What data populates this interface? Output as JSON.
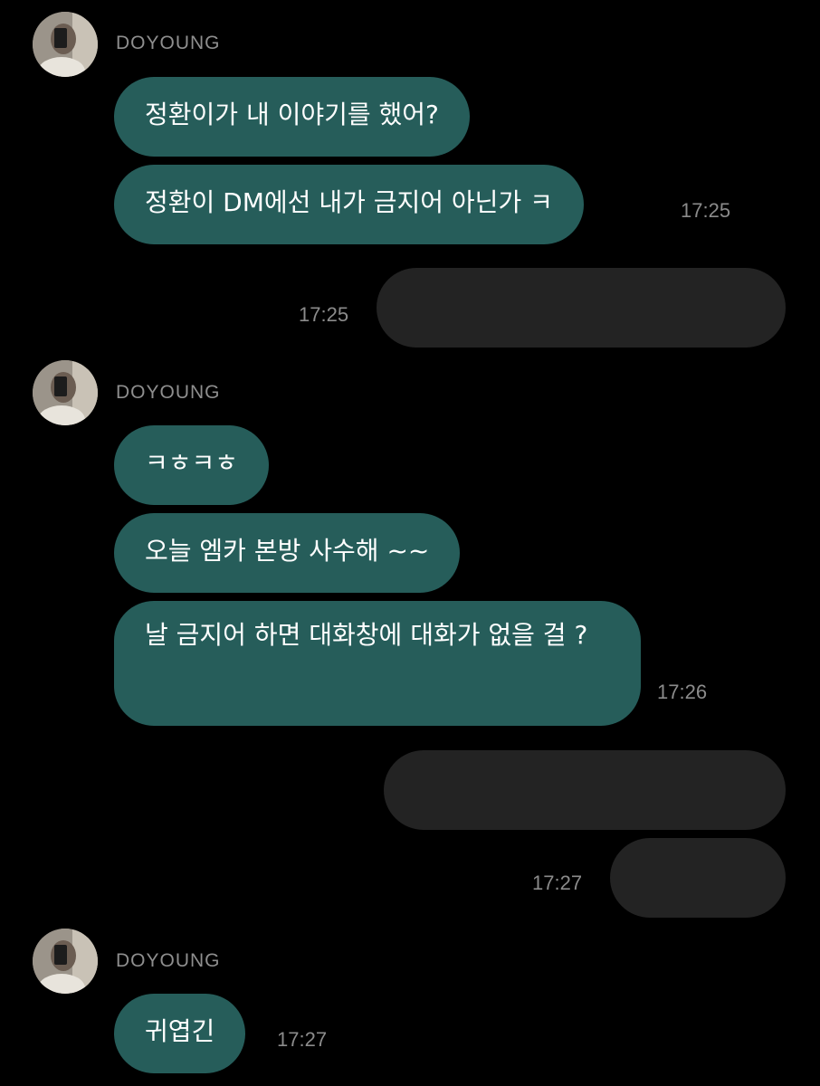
{
  "theme": {
    "background": "#000000",
    "incoming_bubble": "#265d5a",
    "outgoing_bubble": "#232323",
    "text": "#ffffff",
    "muted": "#8b8b8b"
  },
  "groups": [
    {
      "sender": "DOYOUNG",
      "avatar_icon": "profile-photo",
      "messages": [
        {
          "text": "정환이가 내 이야기를 했어?"
        },
        {
          "text": "정환이 DM에선 내가 금지어 아닌가 ㅋ",
          "time": "17:25"
        }
      ]
    },
    {
      "outgoing": [
        {
          "text": "",
          "time": "17:25"
        }
      ]
    },
    {
      "sender": "DOYOUNG",
      "avatar_icon": "profile-photo",
      "messages": [
        {
          "text": "ㅋㅎㅋㅎ"
        },
        {
          "text": "오늘 엠카 본방 사수해 ~~"
        },
        {
          "text": "날 금지어 하면 대화창에 대화가 없을 걸 ?",
          "time": "17:26"
        }
      ]
    },
    {
      "outgoing": [
        {
          "text": ""
        },
        {
          "text": "",
          "time": "17:27"
        }
      ]
    },
    {
      "sender": "DOYOUNG",
      "avatar_icon": "profile-photo",
      "messages": [
        {
          "text": "귀엽긴",
          "time": "17:27"
        }
      ]
    }
  ]
}
